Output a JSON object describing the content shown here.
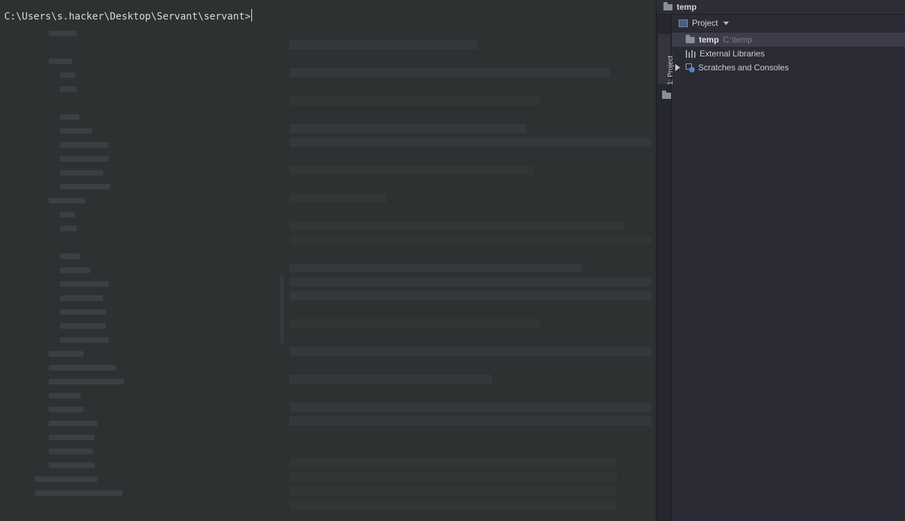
{
  "terminal": {
    "prompt": "C:\\Users\\s.hacker\\Desktop\\Servant\\servant>"
  },
  "tool_window": {
    "header_title": "temp",
    "stripe_tab_label": "1: Project",
    "view_selector_label": "Project",
    "tree": [
      {
        "name": "temp",
        "path": "C:\\temp",
        "icon": "folder-icon",
        "selected": true
      },
      {
        "name": "External Libraries",
        "icon": "library-icon"
      },
      {
        "name": "Scratches and Consoles",
        "icon": "scratches-icon",
        "collapsed": true
      }
    ]
  }
}
